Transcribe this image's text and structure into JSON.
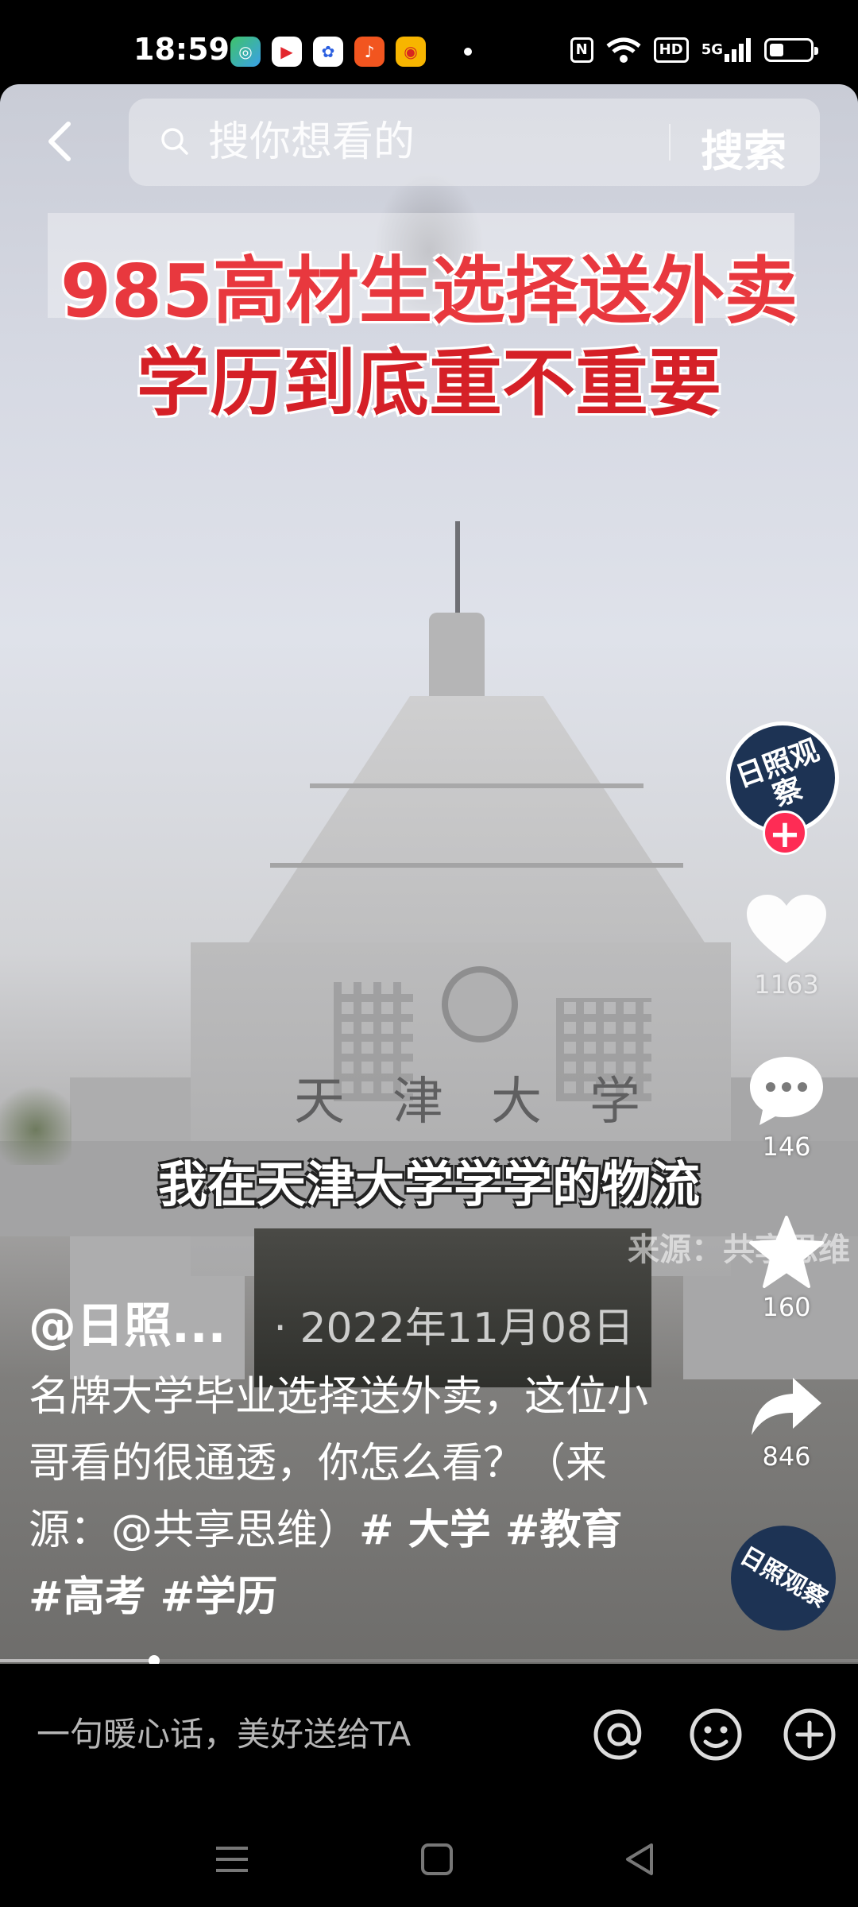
{
  "status_bar": {
    "time": "18:59",
    "network_label": "5G",
    "hd_label": "HD",
    "nfc_label": "N",
    "apps": [
      "green-app-icon",
      "video-app-icon",
      "baidu-app-icon",
      "orange-app-icon",
      "weibo-app-icon"
    ],
    "battery_level": 0.35
  },
  "search": {
    "placeholder": "搜你想看的",
    "button_label": "搜索"
  },
  "video": {
    "title_line1": "985高材生选择送外卖",
    "title_line2": "学历到底重不重要",
    "subtitle": "我在天津大学学学的物流",
    "watermark": "来源：共享思维",
    "gate_name": "天津大学"
  },
  "author": {
    "name": "@日照...",
    "avatar_text": "日照观察",
    "post_date": "· 2022年11月08日"
  },
  "caption": {
    "text": "名牌大学毕业选择送外卖，这位小哥看的很通透，你怎么看？（来源：@共享思维）",
    "hashtags": "# 大学 #教育 #高考 #学历"
  },
  "actions": {
    "likes": "1163",
    "comments": "146",
    "favorites": "160",
    "shares": "846"
  },
  "music_disc_text": "日照观察",
  "playback_progress": 0.18,
  "comment_bar": {
    "placeholder": "一句暖心话，美好送给TA"
  },
  "colors": {
    "accent_red": "#fe2c55",
    "title_red": "#e8383e",
    "avatar_navy": "#1d3354"
  }
}
